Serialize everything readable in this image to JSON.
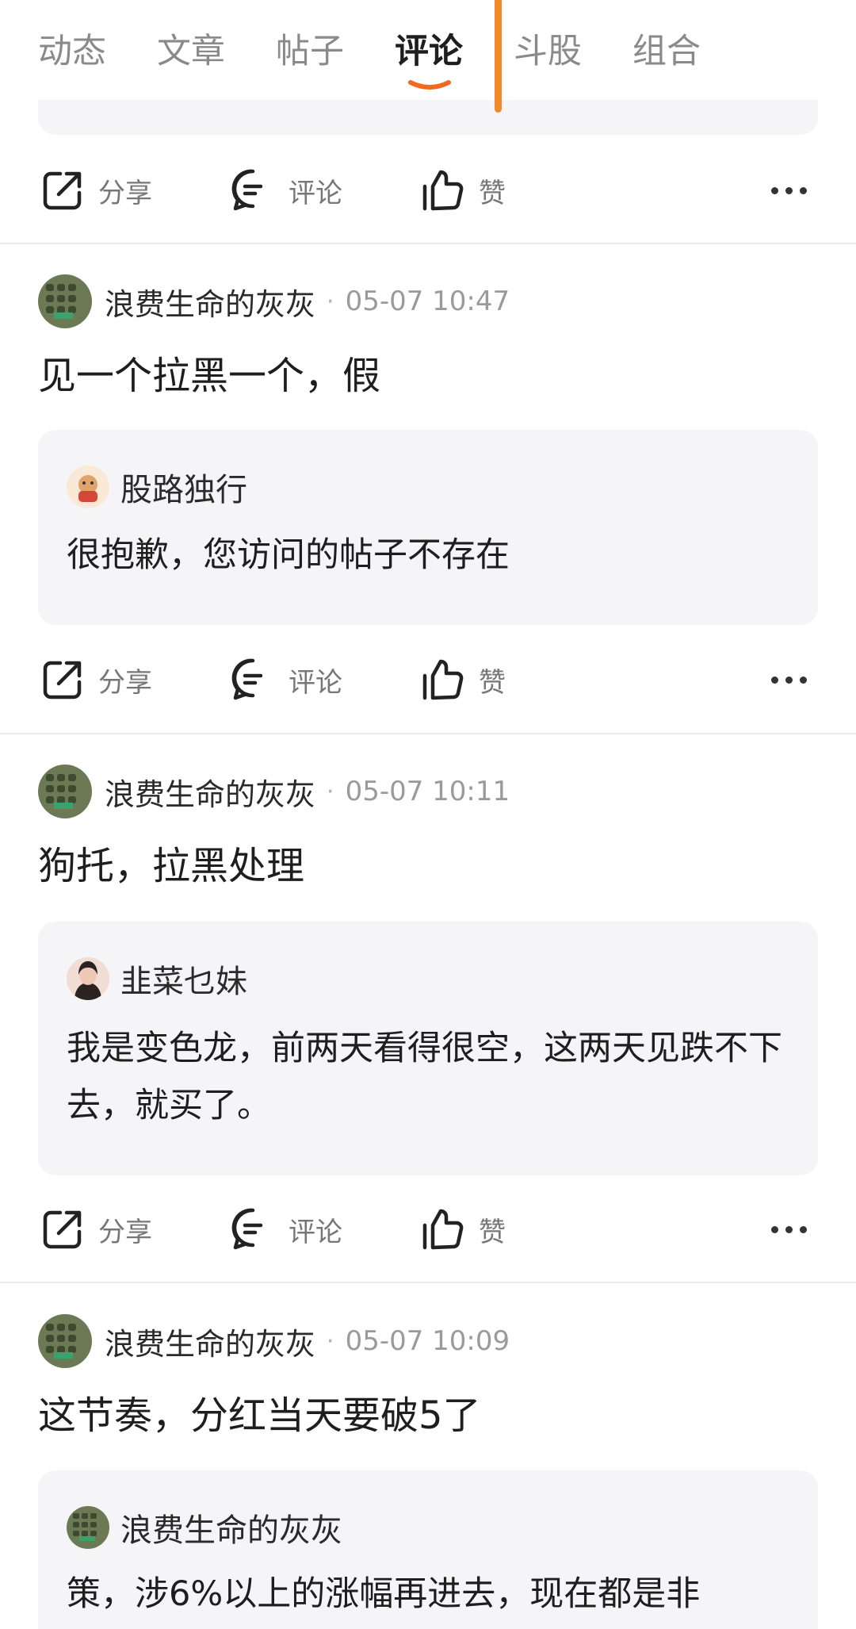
{
  "tabs": [
    {
      "label": "动态",
      "active": false
    },
    {
      "label": "文章",
      "active": false
    },
    {
      "label": "帖子",
      "active": false
    },
    {
      "label": "评论",
      "active": true
    },
    {
      "label": "斗股",
      "active": false
    },
    {
      "label": "组合",
      "active": false
    }
  ],
  "actions": {
    "share": "分享",
    "comment": "评论",
    "like": "赞"
  },
  "posts": [
    {
      "author": "浪费生命的灰灰",
      "sep": "·",
      "time": "05-07 10:47",
      "text": "见一个拉黑一个，假",
      "quote": {
        "author": "股路独行",
        "text": "很抱歉，您访问的帖子不存在"
      }
    },
    {
      "author": "浪费生命的灰灰",
      "sep": "·",
      "time": "05-07 10:11",
      "text": "狗托，拉黑处理",
      "quote": {
        "author": "韭菜乜妹",
        "text": "我是变色龙，前两天看得很空，这两天见跌不下去，就买了。"
      }
    },
    {
      "author": "浪费生命的灰灰",
      "sep": "·",
      "time": "05-07 10:09",
      "text": "这节奏，分红当天要破5了",
      "quote": {
        "author": "浪费生命的灰灰",
        "text": "策，涉6%以上的涨幅再进去，现在都是非"
      }
    }
  ],
  "colors": {
    "accent": "#f28a2c",
    "quote_bg": "#f5f5f7"
  }
}
